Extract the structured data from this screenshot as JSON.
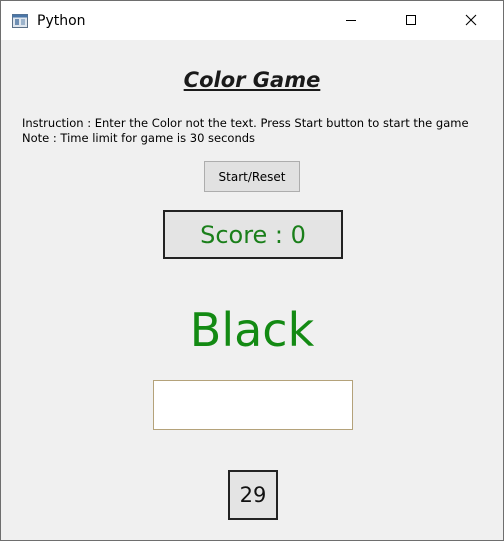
{
  "window": {
    "title": "Python",
    "app_icon": "python-window-icon",
    "controls": {
      "minimize_icon": "minimize-icon",
      "maximize_icon": "maximize-icon",
      "close_icon": "close-icon"
    }
  },
  "game": {
    "heading": "Color Game",
    "instruction": "Instruction : Enter the Color not the text. Press Start button to start the game",
    "note": "Note : Time limit for game is 30 seconds",
    "start_button_label": "Start/Reset",
    "score_text": "Score : 0",
    "color_word": "Black",
    "color_word_color": "#138a13",
    "answer_value": "",
    "timer_value": "29"
  }
}
